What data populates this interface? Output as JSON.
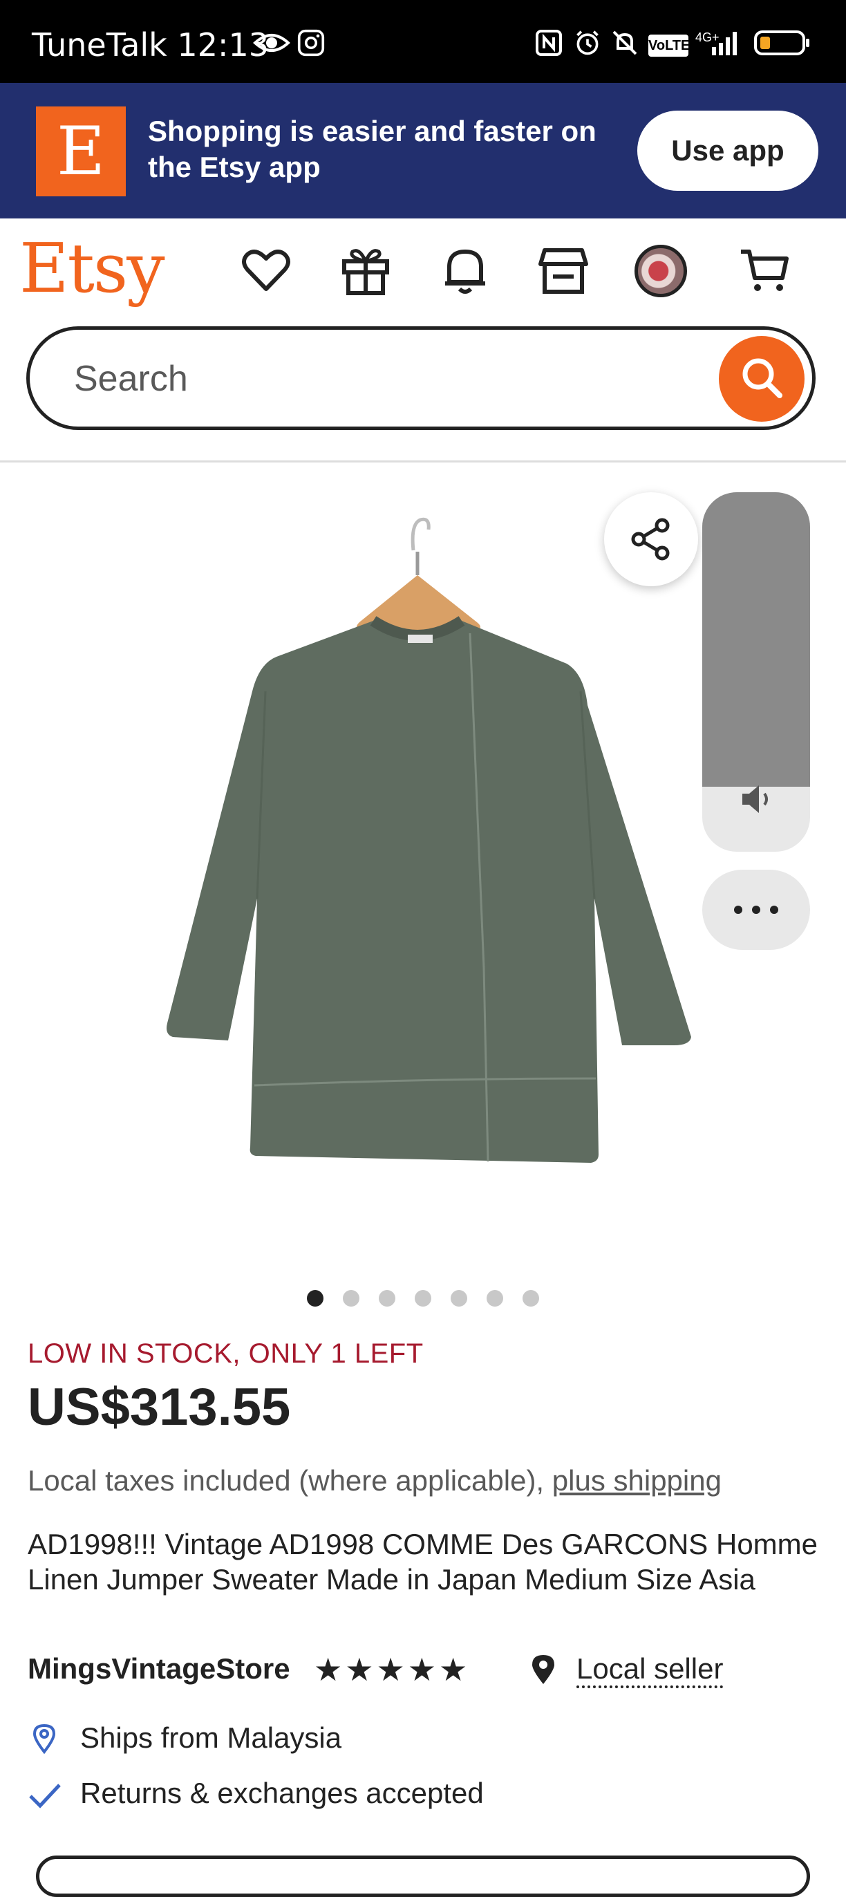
{
  "status_bar": {
    "carrier_time": "TuneTalk 12:13",
    "network": "4G+",
    "volte": "VoLTE"
  },
  "app_banner": {
    "logo_letter": "E",
    "text": "Shopping is easier and faster on the Etsy app",
    "button_label": "Use app"
  },
  "header": {
    "logo": "Etsy",
    "icons": [
      "heart-icon",
      "gift-icon",
      "bell-icon",
      "shop-icon",
      "avatar",
      "cart-icon"
    ]
  },
  "search": {
    "placeholder": "Search"
  },
  "gallery": {
    "image_count": 7,
    "active_index": 0,
    "volume_level": 0.82
  },
  "listing": {
    "stock": "LOW IN STOCK, ONLY 1 LEFT",
    "price": "US$313.55",
    "tax_text": "Local taxes included (where applicable),",
    "shipping_link": "plus shipping",
    "title": "AD1998!!! Vintage AD1998 COMME Des GARCONS Homme Linen Jumper Sweater Made in Japan Medium Size Asia",
    "seller": "MingsVintageStore",
    "rating_stars": "★★★★★",
    "local_seller": "Local seller",
    "ships_from": "Ships from Malaysia",
    "returns": "Returns & exchanges accepted"
  },
  "colors": {
    "brand_orange": "#F1641E",
    "banner_blue": "#222F6E",
    "stock_red": "#A61A2E"
  }
}
